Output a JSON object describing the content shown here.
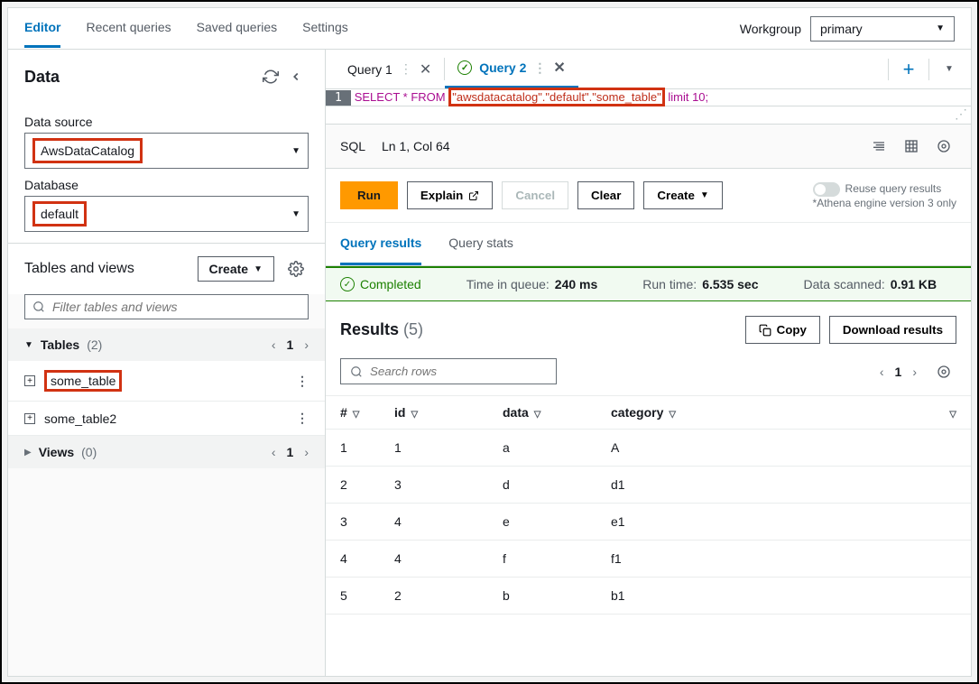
{
  "topbar": {
    "tabs": [
      "Editor",
      "Recent queries",
      "Saved queries",
      "Settings"
    ],
    "workgroup_label": "Workgroup",
    "workgroup_value": "primary"
  },
  "sidebar": {
    "title": "Data",
    "datasource_label": "Data source",
    "datasource_value": "AwsDataCatalog",
    "database_label": "Database",
    "database_value": "default",
    "tv_title": "Tables and views",
    "create_label": "Create",
    "filter_placeholder": "Filter tables and views",
    "tables_label": "Tables",
    "tables_count": "(2)",
    "tables_page": "1",
    "views_label": "Views",
    "views_count": "(0)",
    "views_page": "1",
    "tables": [
      {
        "name": "some_table"
      },
      {
        "name": "some_table2"
      }
    ]
  },
  "query": {
    "tabs": [
      {
        "label": "Query 1",
        "active": false
      },
      {
        "label": "Query 2",
        "active": true
      }
    ],
    "line_num": "1",
    "sql_pre": "SELECT * FROM ",
    "sql_hl": "\"awsdatacatalog\".\"default\".\"some_table\"",
    "sql_post": " limit 10;",
    "status_lang": "SQL",
    "status_pos": "Ln 1, Col 64"
  },
  "actions": {
    "run": "Run",
    "explain": "Explain",
    "cancel": "Cancel",
    "clear": "Clear",
    "create": "Create",
    "reuse": "Reuse query results",
    "reuse_note": "*Athena engine version 3 only"
  },
  "results": {
    "tab_results": "Query results",
    "tab_stats": "Query stats",
    "completed": "Completed",
    "queue_label": "Time in queue:",
    "queue_value": "240 ms",
    "runtime_label": "Run time:",
    "runtime_value": "6.535 sec",
    "scanned_label": "Data scanned:",
    "scanned_value": "0.91 KB",
    "title": "Results",
    "count": "(5)",
    "copy": "Copy",
    "download": "Download results",
    "search_placeholder": "Search rows",
    "page": "1",
    "columns": [
      "#",
      "id",
      "data",
      "category"
    ],
    "rows": [
      [
        "1",
        "1",
        "a",
        "A"
      ],
      [
        "2",
        "3",
        "d",
        "d1"
      ],
      [
        "3",
        "4",
        "e",
        "e1"
      ],
      [
        "4",
        "4",
        "f",
        "f1"
      ],
      [
        "5",
        "2",
        "b",
        "b1"
      ]
    ]
  }
}
